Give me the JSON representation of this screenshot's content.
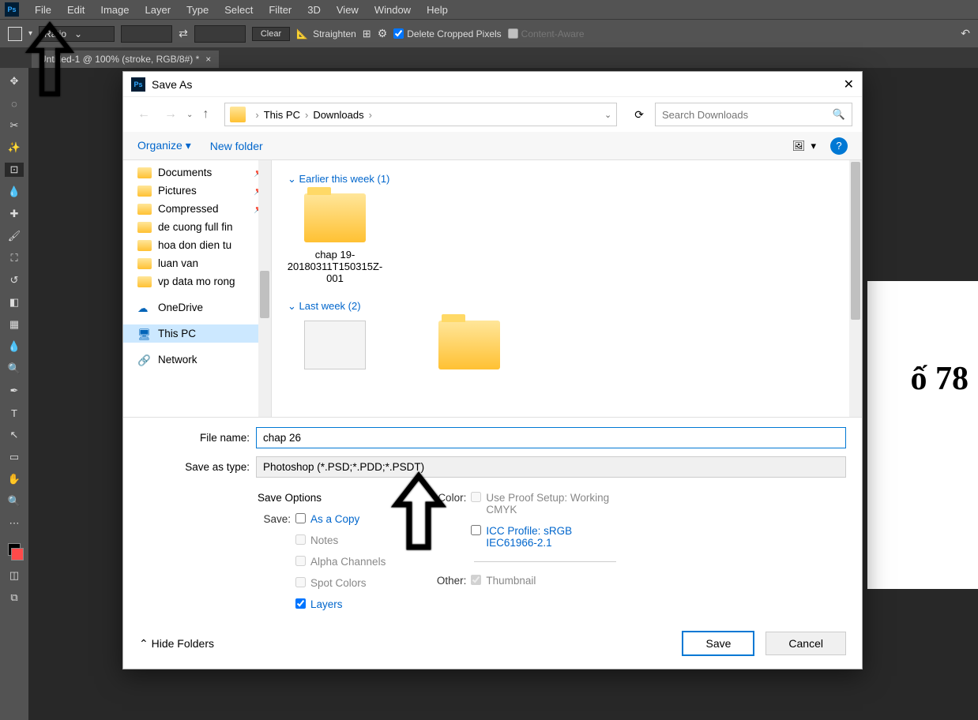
{
  "menubar": [
    "File",
    "Edit",
    "Image",
    "Layer",
    "Type",
    "Select",
    "Filter",
    "3D",
    "View",
    "Window",
    "Help"
  ],
  "optionsbar": {
    "ratio": "Ratio",
    "clear": "Clear",
    "straighten": "Straighten",
    "delete_cropped": "Delete Cropped Pixels",
    "content_aware": "Content-Aware"
  },
  "tab": {
    "title": "Untitled-1 @ 100% (stroke, RGB/8#) *"
  },
  "canvas": {
    "text": "ố 78"
  },
  "dialog": {
    "title": "Save As",
    "breadcrumb": [
      "This PC",
      "Downloads"
    ],
    "search_placeholder": "Search Downloads",
    "organize": "Organize",
    "newfolder": "New folder",
    "sidebar": [
      {
        "label": "Documents",
        "pinned": true
      },
      {
        "label": "Pictures",
        "pinned": true
      },
      {
        "label": "Compressed",
        "pinned": true
      },
      {
        "label": "de cuong full fin",
        "pinned": false
      },
      {
        "label": "hoa don dien tu",
        "pinned": false
      },
      {
        "label": "luan van",
        "pinned": false
      },
      {
        "label": "vp data mo rong",
        "pinned": false
      }
    ],
    "sidebar_special": [
      {
        "label": "OneDrive",
        "icon": "onedrive"
      },
      {
        "label": "This PC",
        "icon": "pc",
        "selected": true
      },
      {
        "label": "Network",
        "icon": "network"
      }
    ],
    "groups": [
      {
        "header": "Earlier this week (1)",
        "items": [
          {
            "name": "chap 19-20180311T150315Z-001",
            "type": "folder"
          }
        ]
      },
      {
        "header": "Last week (2)",
        "items": [
          {
            "name": "",
            "type": "thumb"
          },
          {
            "name": "",
            "type": "folder"
          }
        ]
      }
    ],
    "filename_label": "File name:",
    "filename": "chap 26",
    "filetype_label": "Save as type:",
    "filetype": "Photoshop (*.PSD;*.PDD;*.PSDT)",
    "save_options": "Save Options",
    "save_label": "Save:",
    "as_copy": "As a Copy",
    "notes": "Notes",
    "alpha": "Alpha Channels",
    "spot": "Spot Colors",
    "layers": "Layers",
    "color_label": "Color:",
    "proof": "Use Proof Setup: Working CMYK",
    "icc": "ICC Profile: sRGB IEC61966-2.1",
    "other_label": "Other:",
    "thumbnail": "Thumbnail",
    "hide_folders": "Hide Folders",
    "save_btn": "Save",
    "cancel_btn": "Cancel"
  }
}
